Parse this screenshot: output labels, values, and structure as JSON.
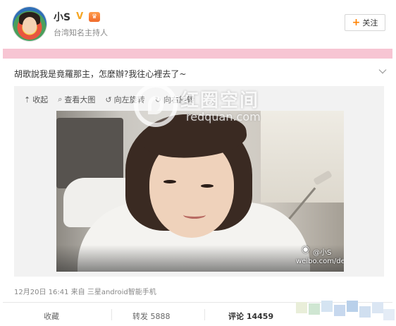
{
  "header": {
    "name": "小S",
    "verified_icon": "verified-v-icon",
    "vip_icon": "vip-badge-icon",
    "subtitle": "台湾知名主持人",
    "follow_label": "关注"
  },
  "post": {
    "text": "胡歌說我是竟羅那主，怎麼辦?我往心裡去了~"
  },
  "media_toolbar": {
    "collapse": "收起",
    "view_large": "查看大图",
    "rotate_left": "向左旋转",
    "rotate_right": "向右旋转"
  },
  "photo_credit": {
    "handle": "@小S",
    "url": "weibo.com/dees"
  },
  "watermark": {
    "title": "红圈空间",
    "subtitle": "redquan.com"
  },
  "meta": {
    "time": "12月20日 16:41",
    "from": "来自",
    "device": "三星android智能手机"
  },
  "actions": {
    "favorite": "收藏",
    "repost": "转发 5888",
    "comment": "评论 14459"
  },
  "colors": {
    "accent_orange": "#ff8200",
    "pink_band": "#f7c5d3"
  }
}
